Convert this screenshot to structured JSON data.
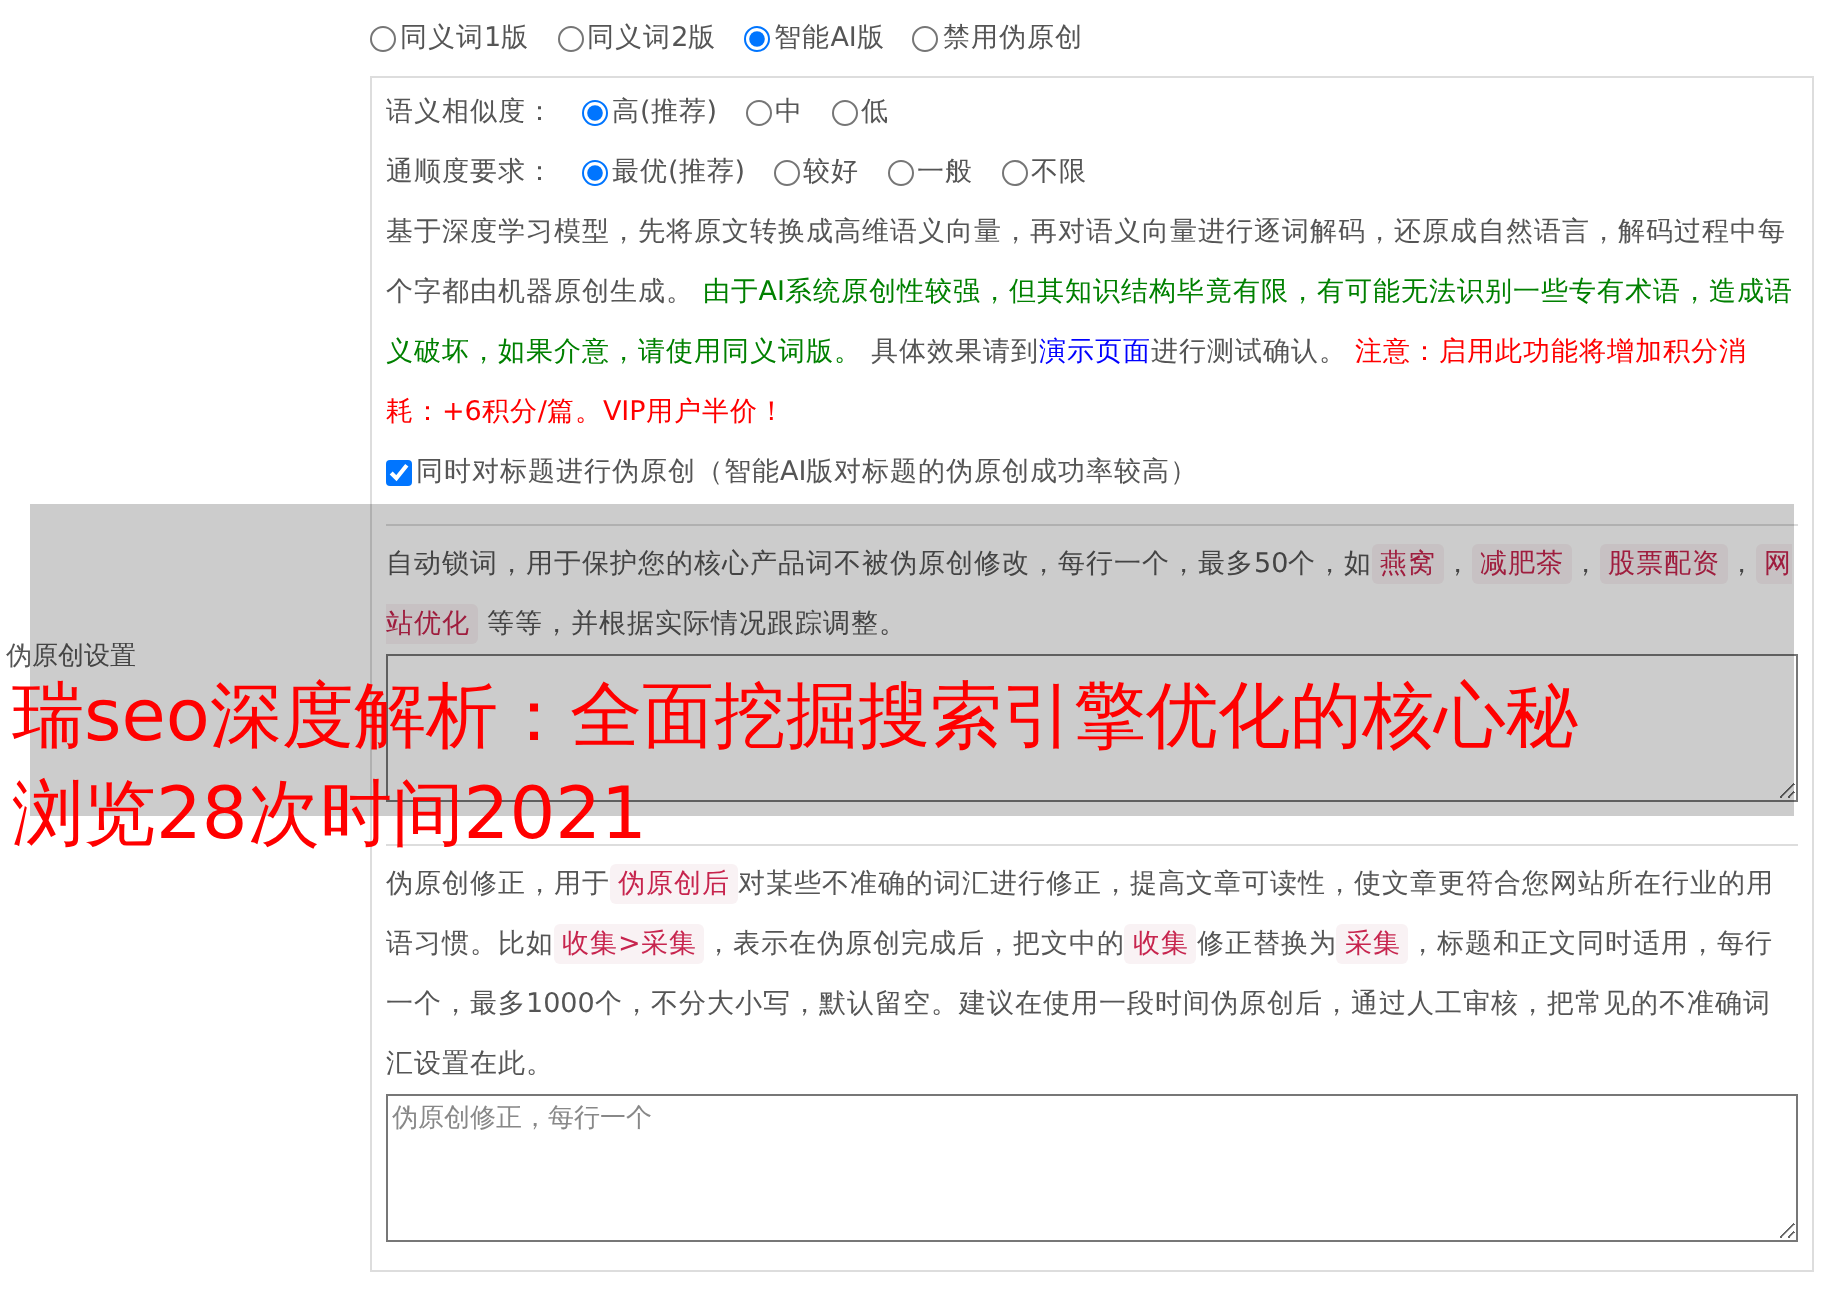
{
  "mode_options": [
    {
      "label": "同义词1版",
      "selected": false
    },
    {
      "label": "同义词2版",
      "selected": false
    },
    {
      "label": "智能AI版",
      "selected": true
    },
    {
      "label": "禁用伪原创",
      "selected": false
    }
  ],
  "section_label": "伪原创设置",
  "similarity": {
    "label": "语义相似度：",
    "options": [
      {
        "label": "高(推荐)",
        "selected": true
      },
      {
        "label": "中",
        "selected": false
      },
      {
        "label": "低",
        "selected": false
      }
    ]
  },
  "fluency": {
    "label": "通顺度要求：",
    "options": [
      {
        "label": "最优(推荐)",
        "selected": true
      },
      {
        "label": "较好",
        "selected": false
      },
      {
        "label": "一般",
        "selected": false
      },
      {
        "label": "不限",
        "selected": false
      }
    ]
  },
  "description": [
    {
      "kind": "plain",
      "text": "基于深度学习模型，先将原文转换成高维语义向量，再对语义向量进行逐词解码，还原成自然语言，解码过程中每个字都由机器原创生成。 "
    },
    {
      "kind": "green",
      "text": "由于AI系统原创性较强，但其知识结构毕竟有限，有可能无法识别一些专有术语，造成语义破坏，如果介意，请使用同义词版。"
    },
    {
      "kind": "plain",
      "text": " 具体效果请到"
    },
    {
      "kind": "link",
      "text": "演示页面"
    },
    {
      "kind": "plain",
      "text": "进行测试确认。 "
    },
    {
      "kind": "warning",
      "text": "注意：启用此功能将增加积分消耗：+6积分/篇。VIP用户半价！"
    }
  ],
  "title_checkbox": {
    "label": "同时对标题进行伪原创（智能AI版对标题的伪原创成功率较高）",
    "checked": true
  },
  "auto_lock": [
    {
      "kind": "plain",
      "text": "自动锁词，用于保护您的核心产品词不被伪原创修改，每行一个，最多50个，如"
    },
    {
      "kind": "code",
      "text": "燕窝"
    },
    {
      "kind": "plain",
      "text": "，"
    },
    {
      "kind": "code",
      "text": "减肥茶"
    },
    {
      "kind": "plain",
      "text": "，"
    },
    {
      "kind": "code",
      "text": "股票配资"
    },
    {
      "kind": "plain",
      "text": "，"
    },
    {
      "kind": "code",
      "text": "网站优化"
    },
    {
      "kind": "plain",
      "text": " 等等，并根据实际情况跟踪调整。"
    }
  ],
  "correction": {
    "text": [
      {
        "kind": "plain",
        "text": "伪原创修正，用于"
      },
      {
        "kind": "code",
        "text": "伪原创后"
      },
      {
        "kind": "plain",
        "text": "对某些不准确的词汇进行修正，提高文章可读性，使文章更符合您网站所在行业的用语习惯。比如"
      },
      {
        "kind": "code",
        "text": "收集>采集"
      },
      {
        "kind": "plain",
        "text": "，表示在伪原创完成后，把文中的"
      },
      {
        "kind": "code",
        "text": "收集"
      },
      {
        "kind": "plain",
        "text": "修正替换为"
      },
      {
        "kind": "code",
        "text": "采集"
      },
      {
        "kind": "plain",
        "text": "，标题和正文同时适用，每行一个，最多1000个，不分大小写，默认留空。建议在使用一段时间伪原创后，通过人工审核，把常见的不准确词汇设置在此。"
      }
    ],
    "placeholder": "伪原创修正，每行一个"
  },
  "overlay": {
    "title": "瑞seo深度解析：全面挖掘搜索引擎优化的核心秘",
    "meta": "浏览28次时间2021"
  }
}
